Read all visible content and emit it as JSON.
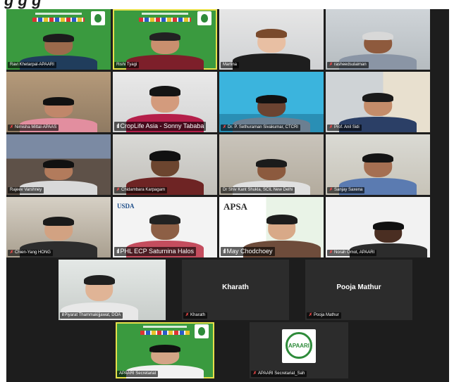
{
  "caption": {
    "text": "g       g       g"
  },
  "tiles": [
    {
      "name": "Ravi Khetarpal-APAARI",
      "mic": "",
      "signal": ""
    },
    {
      "name": "Rishi Tyagi",
      "mic": "",
      "signal": ""
    },
    {
      "name": "Martina",
      "mic": "",
      "signal": ""
    },
    {
      "name": "rasheedsulaiman",
      "mic": "✗",
      "signal": ""
    },
    {
      "name": "Nimisha Mittal-APAAS",
      "mic": "✗",
      "signal": ""
    },
    {
      "name": "CropLife Asia - Sonny Tababa",
      "mic": "",
      "signal": "ıll"
    },
    {
      "name": "Dr. P. Sethuraman Sivakumar, CTCRI",
      "mic": "✗",
      "signal": ""
    },
    {
      "name": "Prof. Anil Sidi",
      "mic": "✗",
      "signal": ""
    },
    {
      "name": "Rajeev Varshney",
      "mic": "",
      "signal": ""
    },
    {
      "name": "Chidambara Karpagam",
      "mic": "✗",
      "signal": ""
    },
    {
      "name": "Dr Shiv Kant Shukla, SCIL New Delhi",
      "mic": "",
      "signal": ""
    },
    {
      "name": "Sanjay Saxena",
      "mic": "✗",
      "signal": ""
    },
    {
      "name": "Chien-Yang HONG",
      "mic": "✗",
      "signal": ""
    },
    {
      "name": "PHL ECP Saturnina Halos",
      "mic": "",
      "signal": "ıll"
    },
    {
      "name": "May Chodchoey",
      "mic": "",
      "signal": "ıll"
    },
    {
      "name": "Norah Omot, APAARI",
      "mic": "✗",
      "signal": ""
    },
    {
      "name": "Piyarat Thammakijjawat, DOA",
      "mic": "",
      "signal": "ıll"
    },
    {
      "name": "Kharath",
      "mic": "✗",
      "signal": "",
      "center": "Kharath"
    },
    {
      "name": "Pooja Mathur",
      "mic": "✗",
      "signal": "",
      "center": "Pooja Mathur"
    },
    {
      "name": "APAARI Secretariat",
      "mic": "",
      "signal": ""
    },
    {
      "name": "APAARI Secretariat_Sah",
      "mic": "✗",
      "signal": "",
      "logo": "APAARI"
    }
  ],
  "signs": {
    "usda": "USDA",
    "apsa": "APSA"
  }
}
